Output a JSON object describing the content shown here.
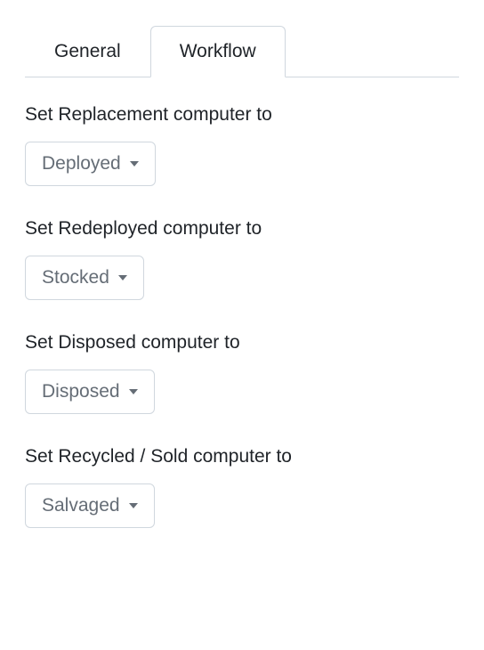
{
  "tabs": [
    {
      "label": "General",
      "active": false
    },
    {
      "label": "Workflow",
      "active": true
    }
  ],
  "fields": [
    {
      "label": "Set Replacement computer to",
      "value": "Deployed"
    },
    {
      "label": "Set Redeployed computer to",
      "value": "Stocked"
    },
    {
      "label": "Set Disposed computer to",
      "value": "Disposed"
    },
    {
      "label": "Set Recycled / Sold computer to",
      "value": "Salvaged"
    }
  ]
}
